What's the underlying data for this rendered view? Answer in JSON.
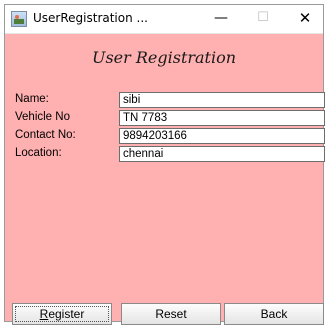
{
  "window": {
    "title": "UserRegistration ...",
    "minimize_glyph": "—",
    "maximize_glyph": "☐",
    "close_glyph": "✕"
  },
  "form": {
    "title": "User Registration",
    "fields": [
      {
        "label": "Name:",
        "value": "sibi"
      },
      {
        "label": "Vehicle No",
        "value": "TN 7783"
      },
      {
        "label": "Contact No:",
        "value": "9894203166"
      },
      {
        "label": "Location:",
        "value": "chennai"
      }
    ]
  },
  "buttons": {
    "register_mnemonic": "R",
    "register_rest": "egister",
    "reset": "Reset",
    "back": "Back"
  },
  "colors": {
    "background": "#ffb0b0"
  }
}
